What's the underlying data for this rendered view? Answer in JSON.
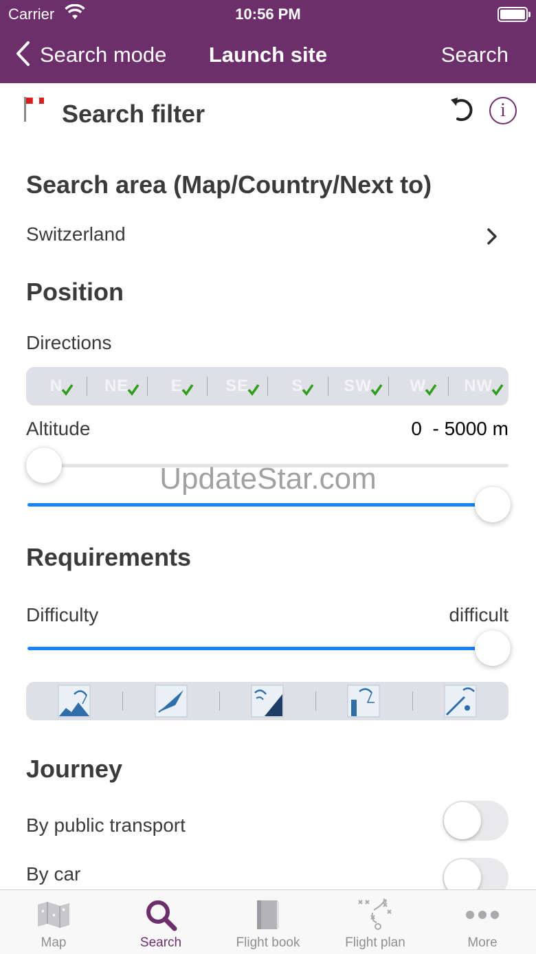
{
  "status_bar": {
    "carrier": "Carrier",
    "time": "10:56 PM"
  },
  "nav": {
    "back_label": "Search mode",
    "title": "Launch site",
    "action_label": "Search"
  },
  "filter": {
    "title": "Search filter",
    "info_glyph": "i"
  },
  "search_area": {
    "heading": "Search area (Map/Country/Next to)",
    "value": "Switzerland"
  },
  "position": {
    "heading": "Position",
    "directions_label": "Directions",
    "directions": [
      "N",
      "NE",
      "E",
      "SE",
      "S",
      "SW",
      "W",
      "NW"
    ],
    "altitude_label": "Altitude",
    "altitude_value": "0  - 5000 m"
  },
  "watermark": "UpdateStar.com",
  "requirements": {
    "heading": "Requirements",
    "difficulty_label": "Difficulty",
    "difficulty_value": "difficult"
  },
  "journey": {
    "heading": "Journey",
    "public_transport_label": "By public transport",
    "car_label": "By car"
  },
  "tabs": [
    {
      "label": "Map",
      "icon": "map-icon"
    },
    {
      "label": "Search",
      "icon": "search-icon"
    },
    {
      "label": "Flight book",
      "icon": "book-icon"
    },
    {
      "label": "Flight plan",
      "icon": "flight-plan-icon"
    },
    {
      "label": "More",
      "icon": "more-icon"
    }
  ],
  "colors": {
    "accent": "#6d2f6b",
    "slider_blue": "#1a82fb",
    "check_green": "#2f9e1e"
  }
}
